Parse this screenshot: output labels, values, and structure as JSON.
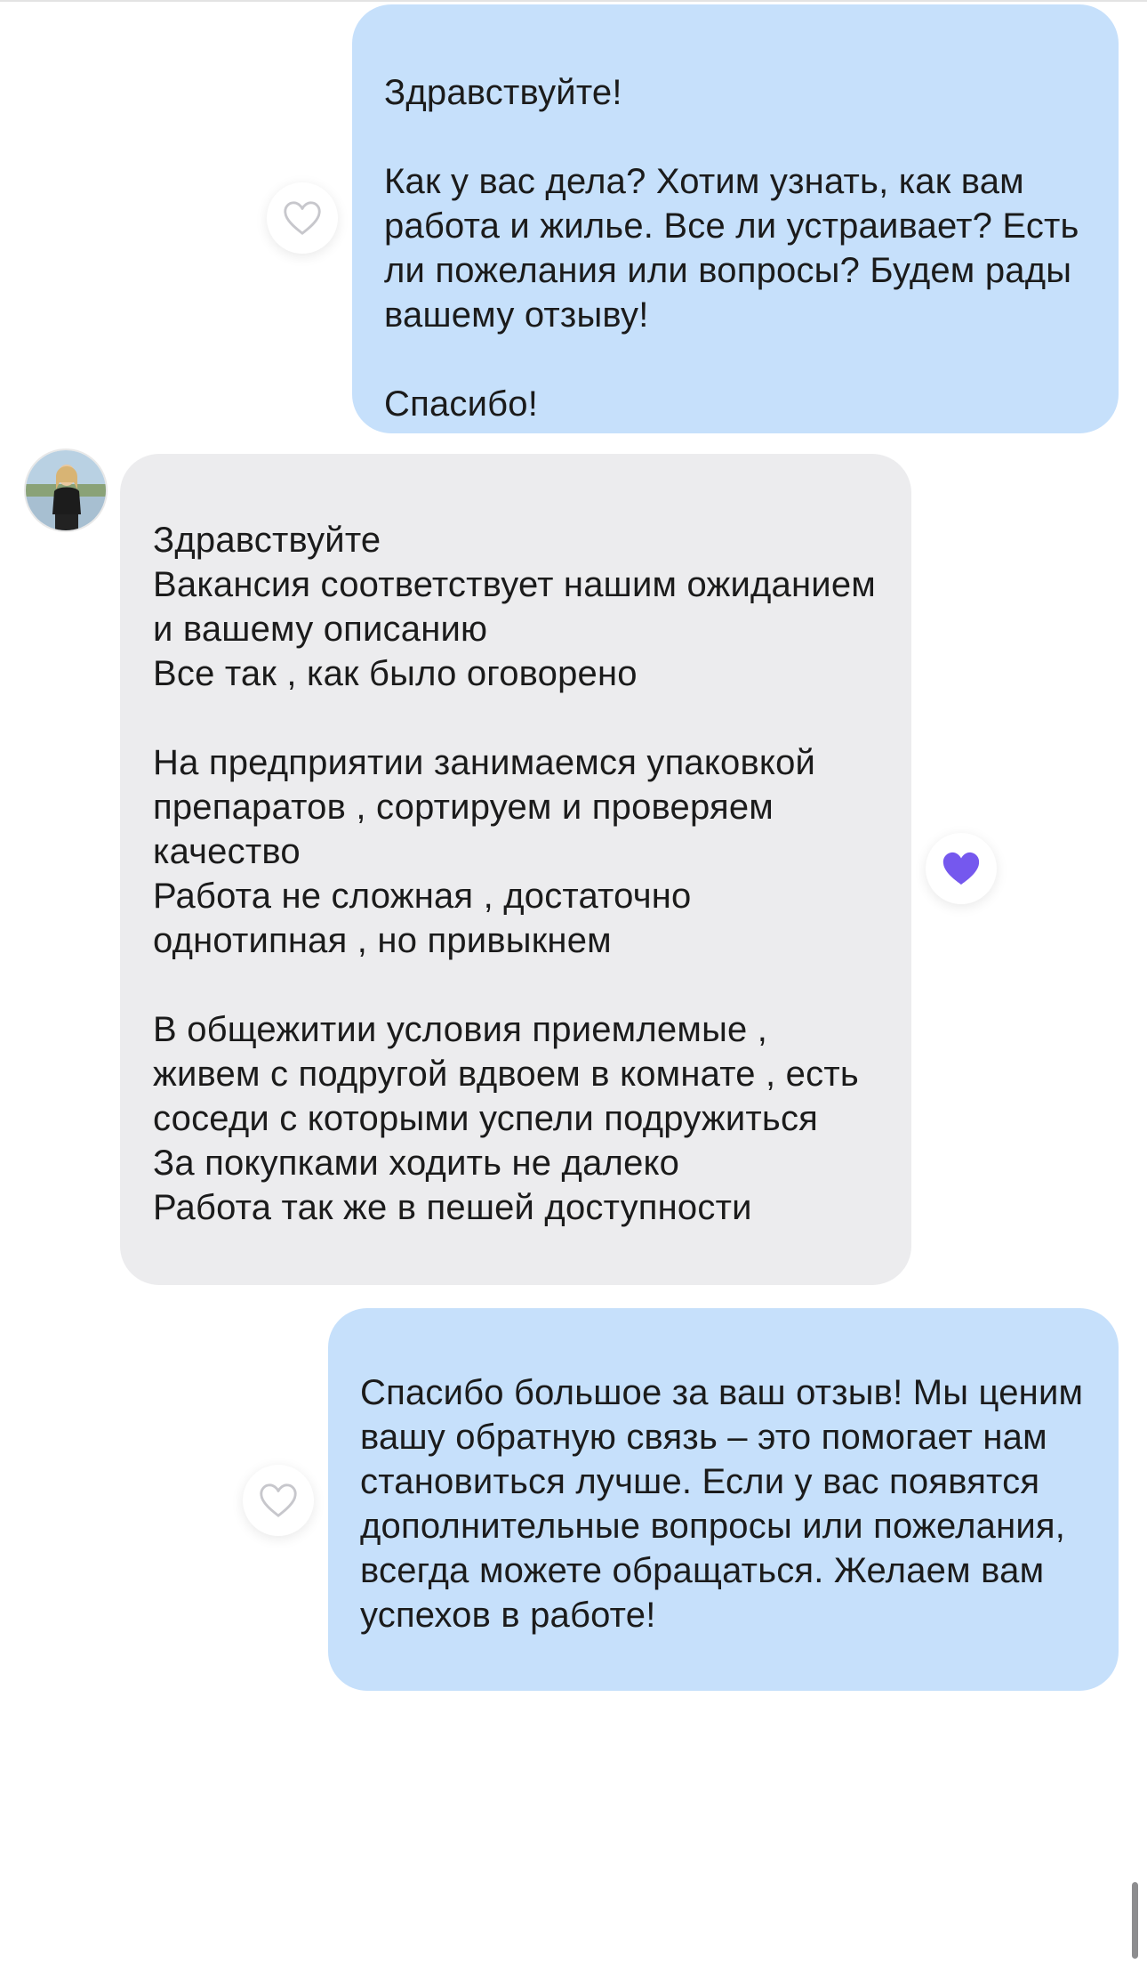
{
  "messages": [
    {
      "direction": "outgoing",
      "text": "Здравствуйте!\n\nКак у вас дела? Хотим узнать, как вам работа и жилье. Все ли устраивает? Есть ли пожелания или вопросы? Будем рады вашему отзыву!\n\nСпасибо!",
      "liked": false,
      "like_icon": "heart-outline-icon"
    },
    {
      "direction": "incoming",
      "text": "Здравствуйте\nВакансия соответствует нашим ожиданием и вашему описанию\nВсе так , как было оговорено\n\nНа предприятии занимаемся упаковкой препаратов , сортируем и проверяем качество\nРабота не сложная , достаточно однотипная , но привыкнем\n\nВ общежитии условия приемлемые , живем с подругой вдвоем в комнате , есть соседи с которыми успели подружиться\nЗа покупками ходить не далеко\nРабота так же в пешей доступности",
      "liked": true,
      "like_icon": "heart-filled-icon",
      "avatar_icon": "user-avatar-photo"
    },
    {
      "direction": "outgoing",
      "text": "Спасибо большое за ваш отзыв! Мы ценим вашу обратную связь – это помогает нам становиться лучше. Если у вас появятся дополнительные вопросы или пожелания, всегда можете обращаться. Желаем вам успехов в работе!",
      "liked": false,
      "like_icon": "heart-outline-icon"
    }
  ],
  "colors": {
    "outgoing_bubble": "#c6e0fb",
    "incoming_bubble": "#ececee",
    "like_active": "#7558ee",
    "like_inactive": "#c7c7cc"
  }
}
